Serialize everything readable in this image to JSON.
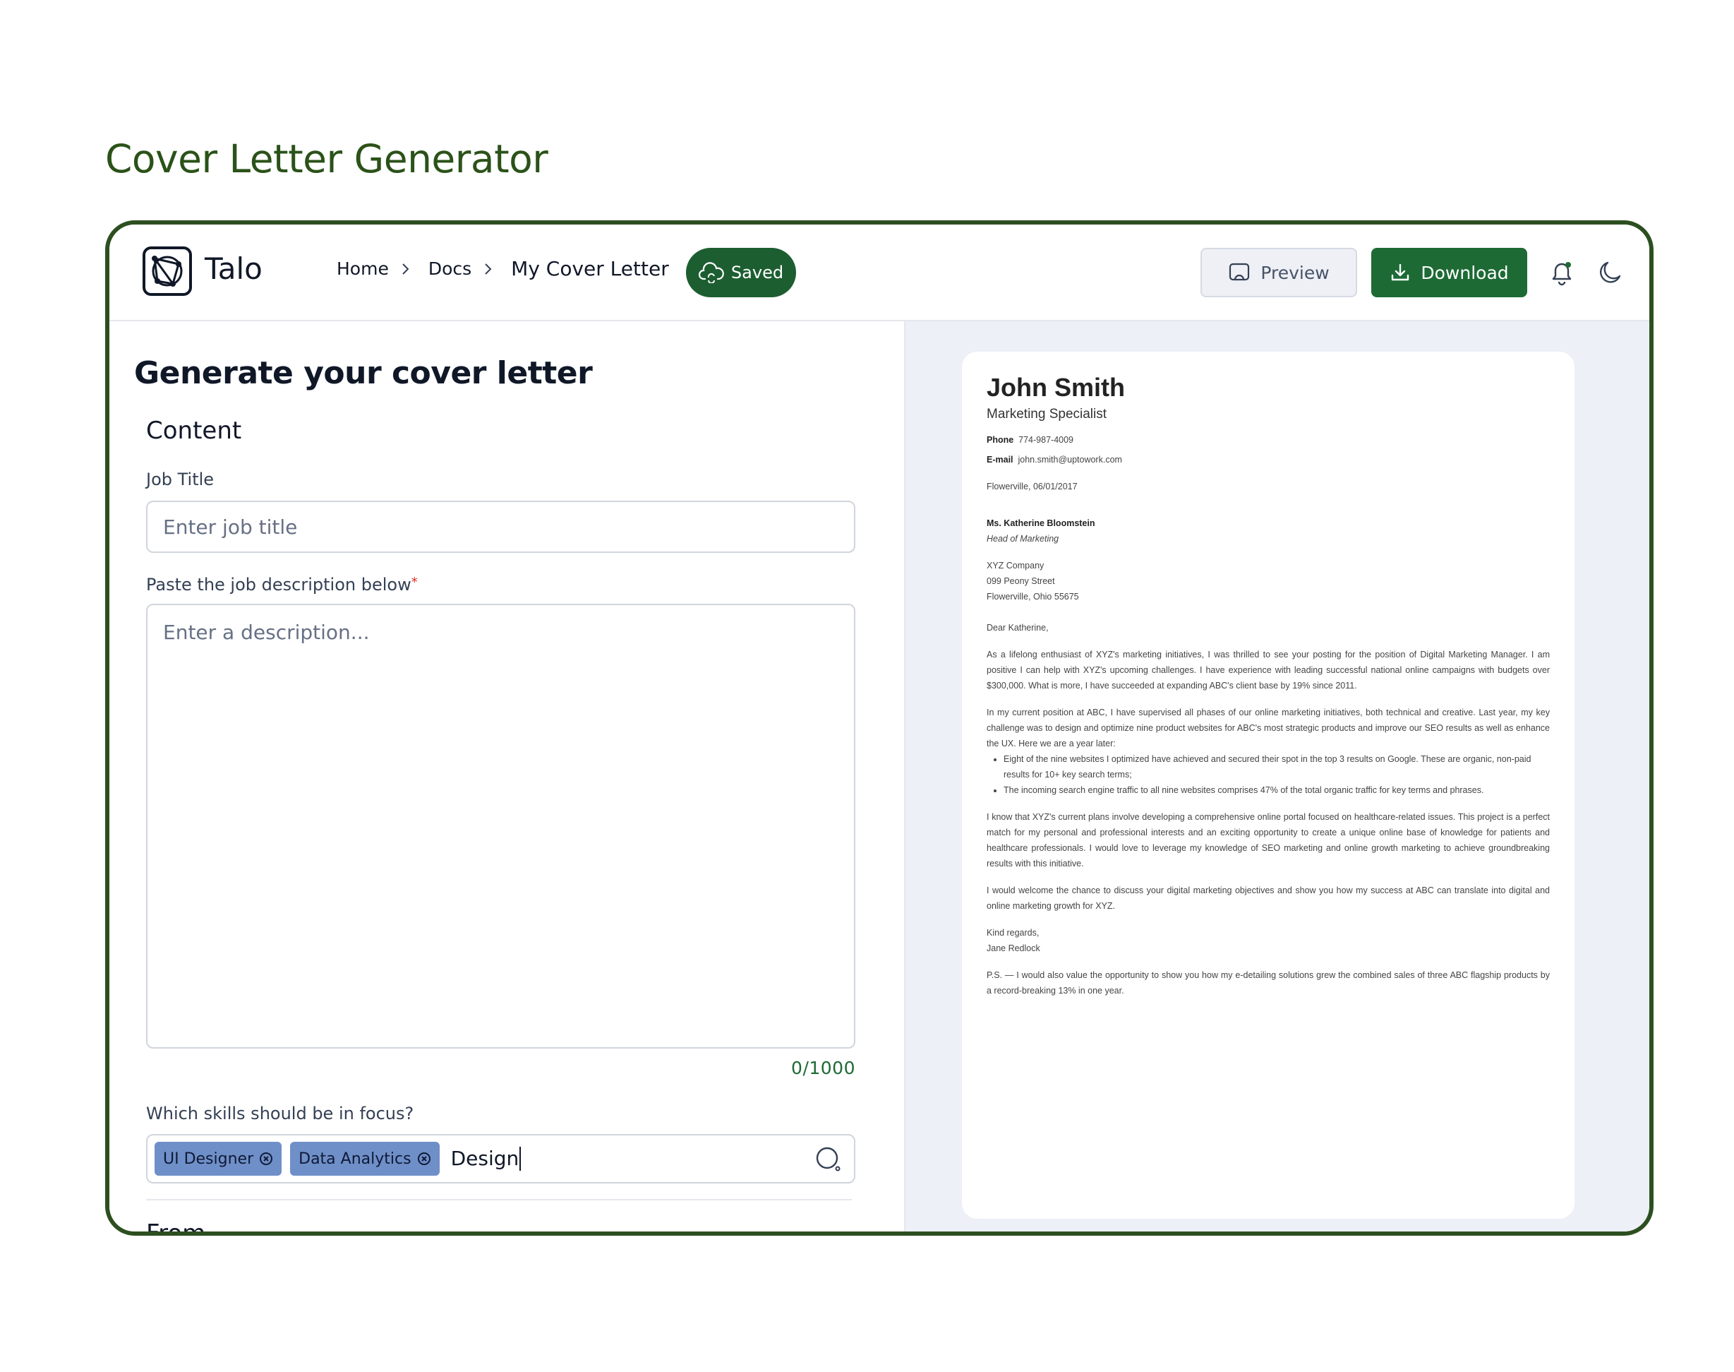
{
  "page": {
    "heading": "Cover Letter Generator"
  },
  "header": {
    "brand": "Talo",
    "breadcrumbs": [
      "Home",
      "Docs"
    ],
    "current": "My Cover Letter",
    "saved_label": "Saved",
    "preview_label": "Preview",
    "download_label": "Download"
  },
  "colors": {
    "brand_green": "#1d6a35",
    "frame_green": "#2d4f20",
    "chip_blue": "#6f8fc8",
    "preview_bg": "#edf0f7"
  },
  "form": {
    "title": "Generate your cover letter",
    "section_content": "Content",
    "job_title_label": "Job Title",
    "job_title_placeholder": "Enter job title",
    "desc_label": "Paste the job description below",
    "desc_required_mark": "*",
    "desc_placeholder": "Enter a description...",
    "char_counter": "0/1000",
    "skills_label": "Which skills should be in focus?",
    "skills": [
      "UI Designer",
      "Data Analytics"
    ],
    "skills_input_value": "Design",
    "section_from": "From"
  },
  "letter": {
    "name": "John Smith",
    "role": "Marketing Specialist",
    "phone_label": "Phone",
    "phone": "774-987-4009",
    "email_label": "E-mail",
    "email": "john.smith@uptowork.com",
    "place_date": "Flowerville, 06/01/2017",
    "recipient_name": "Ms. Katherine Bloomstein",
    "recipient_title": "Head of Marketing",
    "company": "XYZ Company",
    "street": "099 Peony Street",
    "city": "Flowerville, Ohio 55675",
    "greeting": "Dear Katherine,",
    "p1": "As a lifelong enthusiast of XYZ's marketing initiatives, I was thrilled to see your posting for the position of Digital Marketing Manager. I am positive I can help with XYZ's upcoming challenges. I have experience with leading successful national online campaigns with budgets over $300,000. What is more, I have succeeded at expanding ABC's client base by 19% since 2011.",
    "p2": "In my current position at ABC, I have supervised all phases of our online marketing initiatives, both technical and creative. Last year, my key challenge was to design and optimize nine product websites for ABC's most strategic products and improve our SEO results as well as enhance the UX. Here we are a year later:",
    "bullets": [
      "Eight of the nine websites I optimized have achieved and secured their spot in the top 3 results on Google. These are organic, non-paid results for 10+ key search terms;",
      "The incoming search engine traffic to all nine websites comprises 47% of the total organic traffic for key terms and phrases."
    ],
    "p3": "I know that XYZ's current plans involve developing a comprehensive online portal focused on healthcare-related issues. This project is a perfect match for my personal and professional interests and an exciting opportunity to create a unique online base of knowledge for patients and healthcare professionals. I would love to leverage my knowledge of SEO marketing and online growth marketing to achieve groundbreaking results with this initiative.",
    "p4": "I would welcome the chance to discuss your digital marketing objectives and show you how my success at ABC can translate into digital and online marketing growth for XYZ.",
    "closing": "Kind regards,",
    "signature": "Jane Redlock",
    "ps": "P.S. — I would also value the opportunity to show you how my e-detailing solutions grew the combined sales of three ABC flagship products by a record-breaking 13% in one year."
  }
}
